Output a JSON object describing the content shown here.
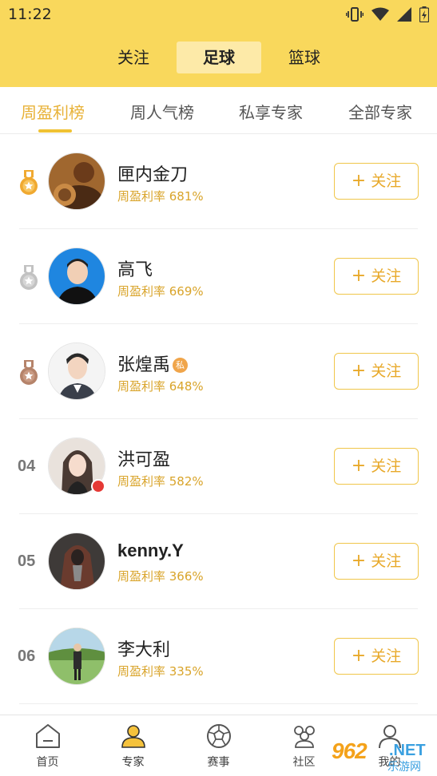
{
  "status_bar": {
    "time": "11:22"
  },
  "categories": [
    {
      "label": "关注",
      "active": false
    },
    {
      "label": "足球",
      "active": true
    },
    {
      "label": "篮球",
      "active": false
    }
  ],
  "tabs": [
    {
      "label": "周盈利榜",
      "active": true
    },
    {
      "label": "周人气榜",
      "active": false
    },
    {
      "label": "私享专家",
      "active": false
    },
    {
      "label": "全部专家",
      "active": false
    }
  ],
  "colors": {
    "accent": "#f9d85c",
    "gold": "#f0a930",
    "silver": "#c2c2c2",
    "bronze": "#b5836a",
    "rate_text": "#d9a42a"
  },
  "experts": [
    {
      "rank": "1",
      "medal": "gold-medal-icon",
      "name": "匣内金刀",
      "rate": "周盈利率 681%",
      "private": false,
      "hot": false,
      "follow": "关注"
    },
    {
      "rank": "2",
      "medal": "silver-medal-icon",
      "name": "高飞",
      "rate": "周盈利率 669%",
      "private": false,
      "hot": false,
      "follow": "关注"
    },
    {
      "rank": "3",
      "medal": "bronze-medal-icon",
      "name": "张煌禹",
      "rate": "周盈利率 648%",
      "private": true,
      "private_label": "私",
      "hot": false,
      "follow": "关注"
    },
    {
      "rank": "04",
      "medal": null,
      "name": "洪可盈",
      "rate": "周盈利率 582%",
      "private": false,
      "hot": true,
      "follow": "关注"
    },
    {
      "rank": "05",
      "medal": null,
      "name": "kenny.Y",
      "rate": "周盈利率 366%",
      "private": false,
      "hot": false,
      "follow": "关注"
    },
    {
      "rank": "06",
      "medal": null,
      "name": "李大利",
      "rate": "周盈利率 335%",
      "private": false,
      "hot": false,
      "follow": "关注"
    }
  ],
  "bottom_nav": [
    {
      "label": "首页",
      "icon": "home-icon",
      "active": false
    },
    {
      "label": "专家",
      "icon": "experts-icon",
      "active": true
    },
    {
      "label": "赛事",
      "icon": "football-icon",
      "active": false
    },
    {
      "label": "社区",
      "icon": "community-icon",
      "active": false
    },
    {
      "label": "我的",
      "icon": "profile-icon",
      "active": false
    }
  ],
  "watermark": {
    "brand": "962",
    "suffix": ".NET",
    "text": "乐游网"
  }
}
